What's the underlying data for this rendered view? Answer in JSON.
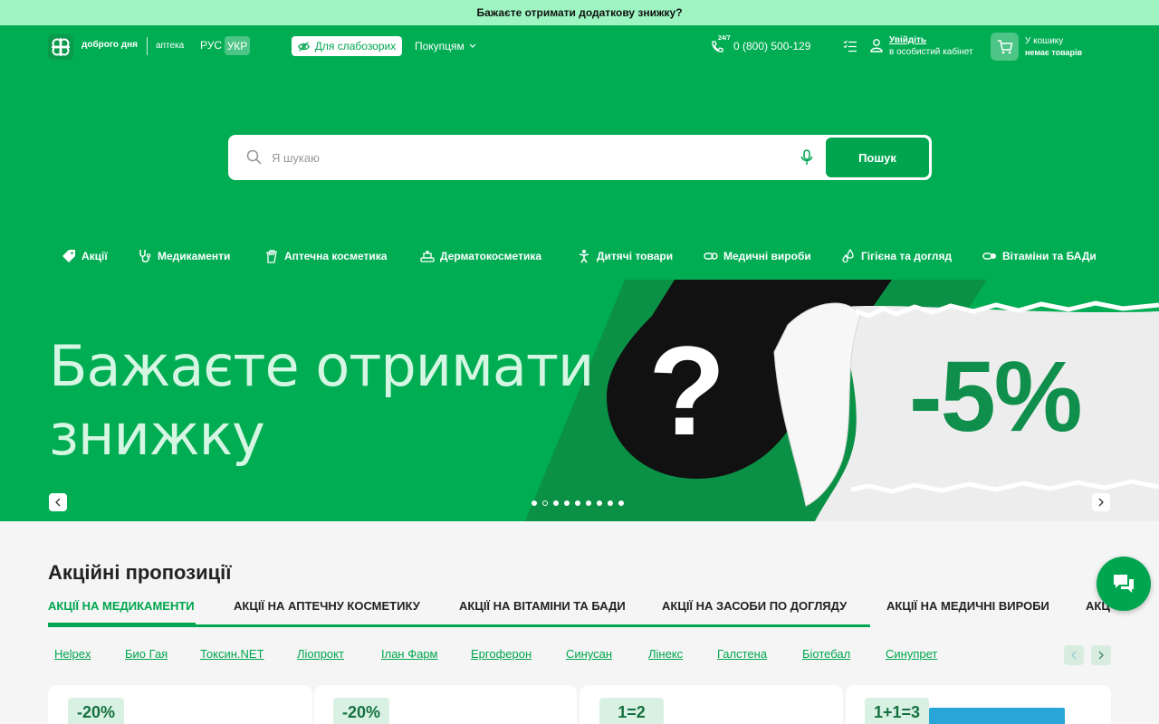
{
  "promo_strip": {
    "text": "Бажаєте отримати додаткову знижку?"
  },
  "header": {
    "logo_text": "доброго дня",
    "logo_sub": "аптека",
    "lang_rus": "РУС",
    "lang_ukr": "УКР",
    "vision_button": "Для слабозорих",
    "buyers_menu": "Покупцям",
    "phone_badge": "24/7",
    "phone": "0 (800) 500-129",
    "login_link": "Увійдіть",
    "login_sub": "в особистий кабінет",
    "cart_title": "У кошику",
    "cart_sub": "немає товарів"
  },
  "search": {
    "placeholder": "Я шукаю",
    "value": "",
    "button": "Пошук"
  },
  "categories": [
    {
      "label": "Акції",
      "icon": "tag-icon"
    },
    {
      "label": "Медикаменти",
      "icon": "stethoscope-icon"
    },
    {
      "label": "Аптечна косметика",
      "icon": "hand-cream-icon"
    },
    {
      "label": "Дерматокосметика",
      "icon": "derma-icon"
    },
    {
      "label": "Дитячі товари",
      "icon": "child-icon"
    },
    {
      "label": "Медичні вироби",
      "icon": "pills-icon"
    },
    {
      "label": "Гігієна та догляд",
      "icon": "drops-icon"
    },
    {
      "label": "Вітаміни та БАДи",
      "icon": "capsule-icon"
    }
  ],
  "banner": {
    "title_line1": "Бажаєте отримати",
    "title_line2": "знижку",
    "question": "?",
    "discount": "-5%",
    "slide_count": 9,
    "active_slide": 2
  },
  "offers": {
    "title": "Акційні пропозиції",
    "tabs": [
      "АКЦІЇ НА МЕДИКАМЕНТИ",
      "АКЦІЇ НА АПТЕЧНУ КОСМЕТИКУ",
      "АКЦІЇ НА ВІТАМІНИ ТА БАДИ",
      "АКЦІЇ НА ЗАСОБИ ПО ДОГЛЯДУ",
      "АКЦІЇ НА МЕДИЧНІ ВИРОБИ",
      "АКЦ"
    ],
    "brands": [
      "Helpex",
      "Био Гая",
      "Токсин.NET",
      "Ліопрокт",
      "Ілан Фарм",
      "Ергоферон",
      "Синусан",
      "Лінекс",
      "Галстена",
      "Біотебал",
      "Синупрет"
    ],
    "badges": [
      "-20%",
      "-20%",
      "1=2",
      "1+1=3"
    ]
  },
  "colors": {
    "brand_green": "#00ad53",
    "promo_strip": "#9ef5c2",
    "dark_green": "#16713f"
  }
}
